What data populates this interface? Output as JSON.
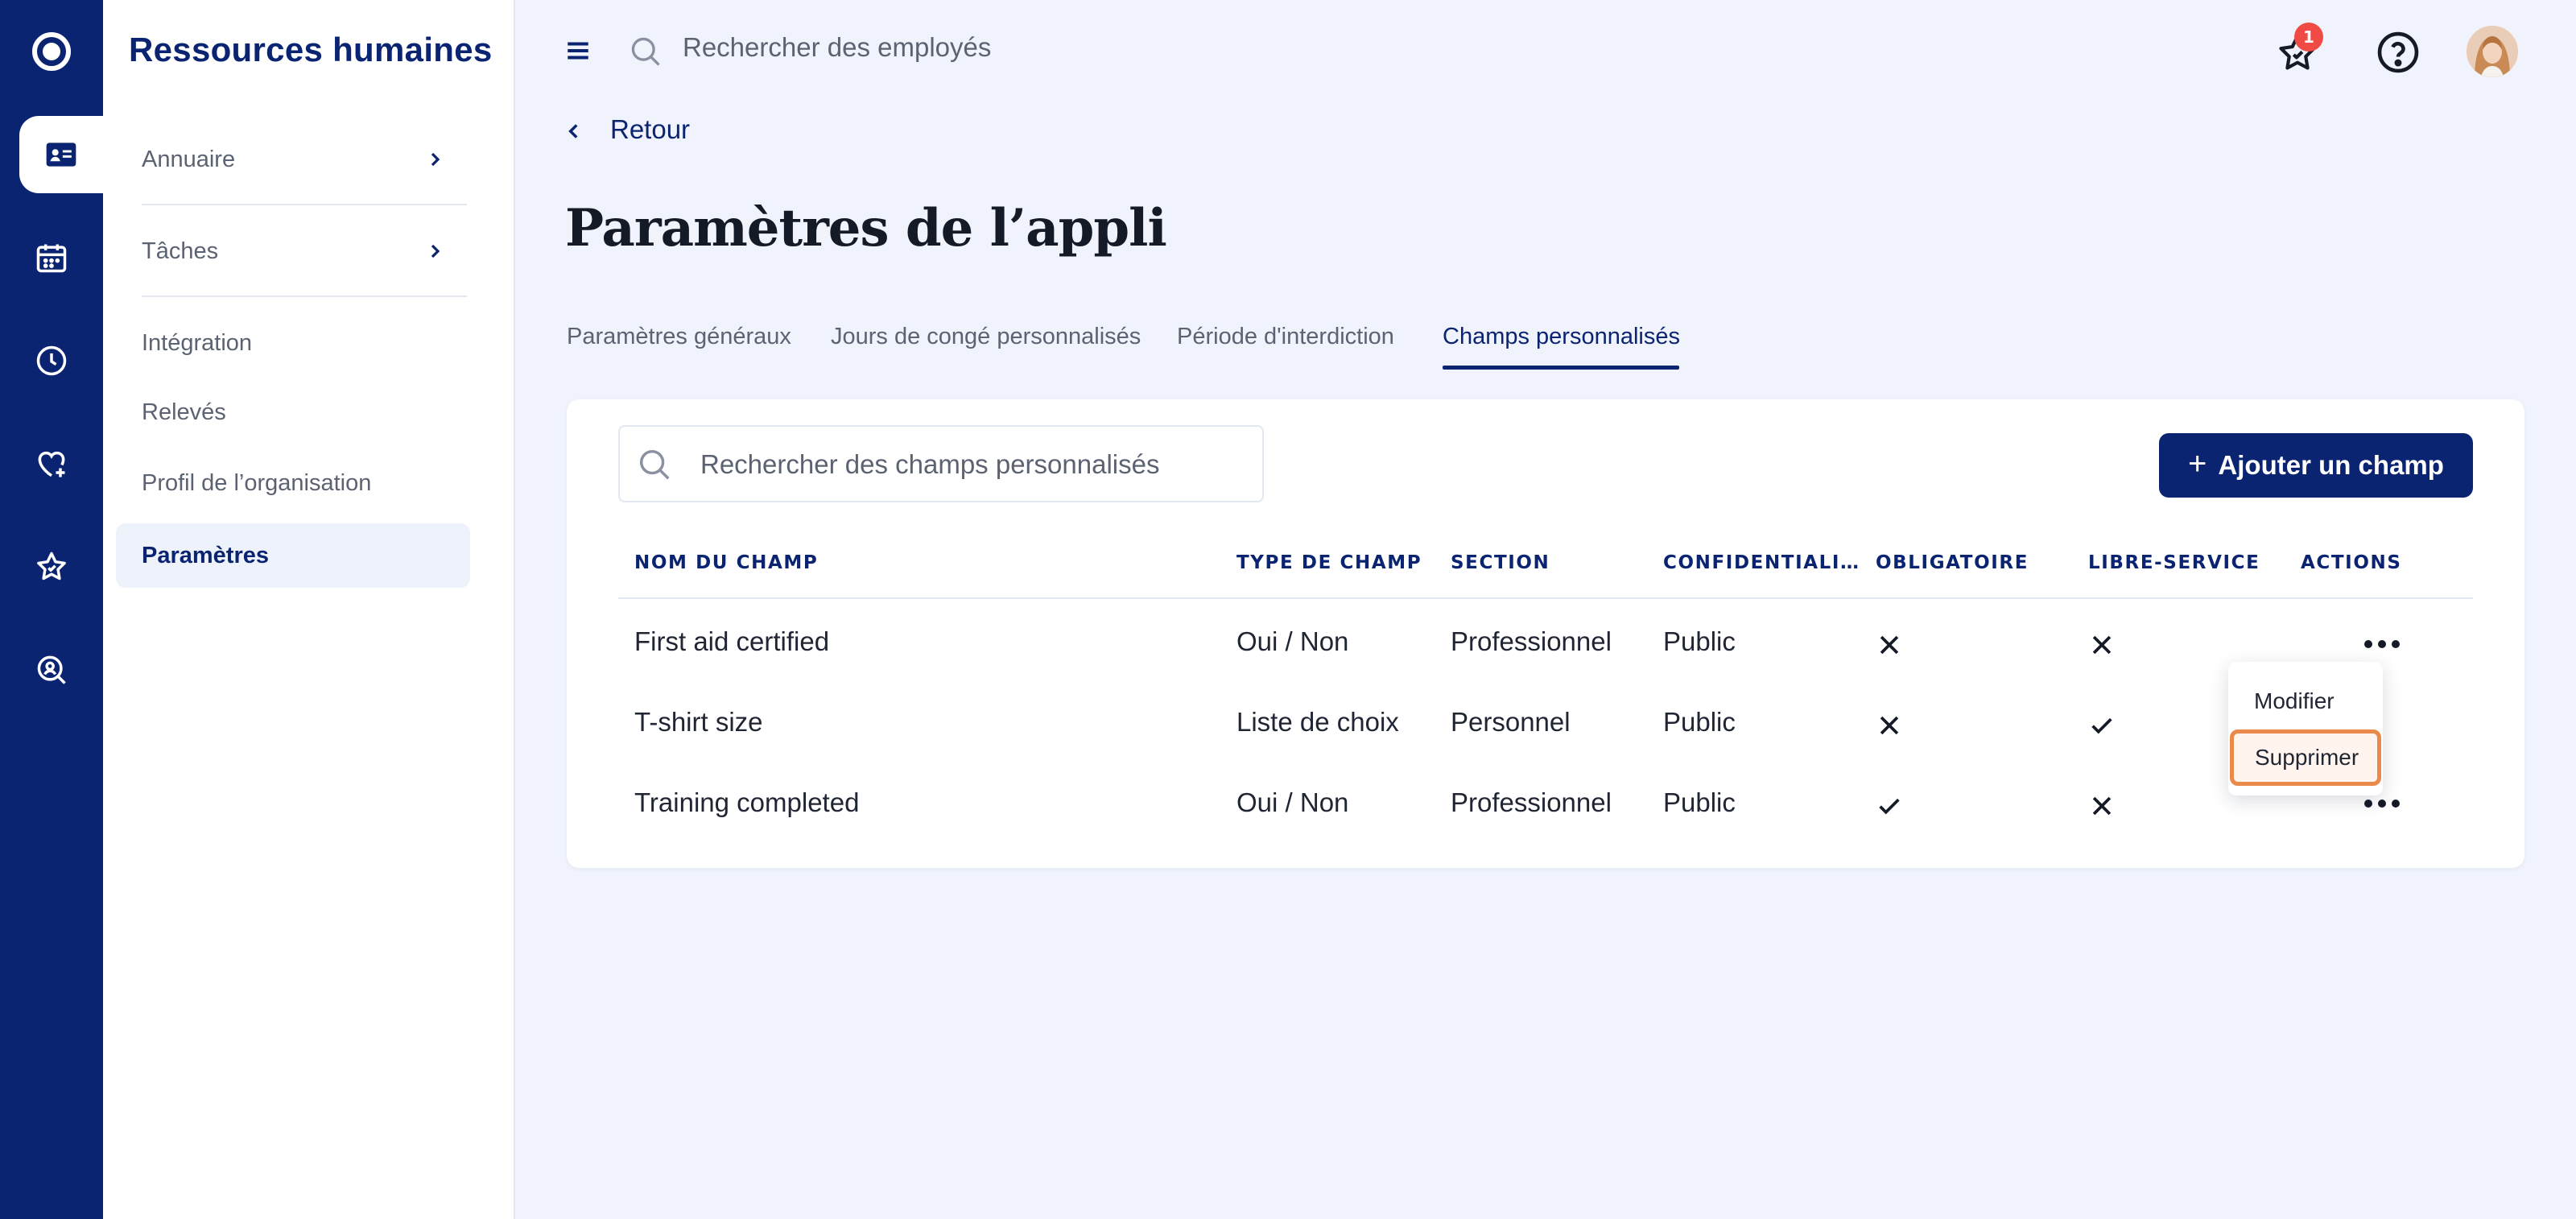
{
  "app": {
    "title": "Ressources humaines"
  },
  "rail": {
    "icons": [
      "logo-icon",
      "employee-card-icon",
      "calendar-icon",
      "clock-icon",
      "heart-plus-icon",
      "star-icon",
      "person-search-icon"
    ]
  },
  "sidebar": {
    "items": [
      {
        "label": "Annuaire"
      },
      {
        "label": "Tâches"
      },
      {
        "label": "Intégration"
      },
      {
        "label": "Relevés"
      },
      {
        "label": "Profil de l’organisation"
      },
      {
        "label": "Paramètres"
      }
    ]
  },
  "topbar": {
    "search_placeholder": "Rechercher des employés",
    "notification_count": "1"
  },
  "back": {
    "label": "Retour"
  },
  "page": {
    "title": "Paramètres de l’appli"
  },
  "tabs": [
    {
      "label": "Paramètres généraux"
    },
    {
      "label": "Jours de congé personnalisés"
    },
    {
      "label": "Période d'interdiction"
    },
    {
      "label": "Champs personnalisés"
    }
  ],
  "card": {
    "search_placeholder": "Rechercher des champs personnalisés",
    "add_button": "Ajouter un champ",
    "add_plus": "+"
  },
  "table": {
    "headers": [
      "NOM DU CHAMP",
      "TYPE DE CHAMP",
      "SECTION",
      "CONFIDENTIALI…",
      "OBLIGATOIRE",
      "LIBRE-SERVICE",
      "ACTIONS"
    ],
    "rows": [
      {
        "name": "First aid certified",
        "type": "Oui / Non",
        "section": "Professionnel",
        "privacy": "Public",
        "required": false,
        "self_service": false
      },
      {
        "name": "T-shirt size",
        "type": "Liste de choix",
        "section": "Personnel",
        "privacy": "Public",
        "required": false,
        "self_service": true
      },
      {
        "name": "Training completed",
        "type": "Oui / Non",
        "section": "Professionnel",
        "privacy": "Public",
        "required": true,
        "self_service": false
      }
    ]
  },
  "menu": {
    "items": [
      {
        "label": "Modifier"
      },
      {
        "label": "Supprimer"
      }
    ]
  }
}
